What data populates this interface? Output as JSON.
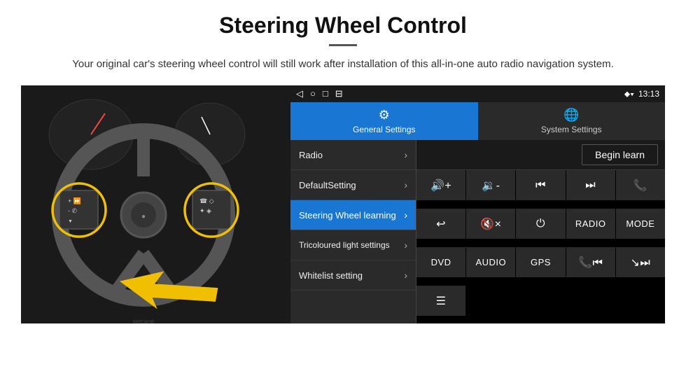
{
  "page": {
    "title": "Steering Wheel Control",
    "subtitle": "Your original car's steering wheel control will still work after installation of this all-in-one auto radio navigation system."
  },
  "status_bar": {
    "nav_back": "◁",
    "nav_home": "○",
    "nav_square": "□",
    "nav_extra": "⊟",
    "time": "13:13",
    "signal": "▼▲",
    "wifi": "⊕"
  },
  "tabs": [
    {
      "id": "general",
      "label": "General Settings",
      "active": true
    },
    {
      "id": "system",
      "label": "System Settings",
      "active": false
    }
  ],
  "menu_items": [
    {
      "id": "radio",
      "label": "Radio",
      "active": false
    },
    {
      "id": "default",
      "label": "DefaultSetting",
      "active": false
    },
    {
      "id": "steering",
      "label": "Steering Wheel learning",
      "active": true
    },
    {
      "id": "tricoloured",
      "label": "Tricoloured light settings",
      "active": false
    },
    {
      "id": "whitelist",
      "label": "Whitelist setting",
      "active": false
    }
  ],
  "begin_learn_label": "Begin learn",
  "control_buttons": [
    {
      "id": "vol-up",
      "label": "🔊+"
    },
    {
      "id": "vol-down",
      "label": "🔉-"
    },
    {
      "id": "prev-track",
      "label": "⏮"
    },
    {
      "id": "next-track",
      "label": "⏭"
    },
    {
      "id": "phone",
      "label": "📞"
    },
    {
      "id": "back",
      "label": "↩"
    },
    {
      "id": "mute",
      "label": "🔇×"
    },
    {
      "id": "power",
      "label": "⏻"
    },
    {
      "id": "radio-btn",
      "label": "RADIO"
    },
    {
      "id": "mode",
      "label": "MODE"
    },
    {
      "id": "dvd",
      "label": "DVD"
    },
    {
      "id": "audio",
      "label": "AUDIO"
    },
    {
      "id": "gps",
      "label": "GPS"
    },
    {
      "id": "tel-prev",
      "label": "📞⏮"
    },
    {
      "id": "next-end",
      "label": "↘⏭"
    },
    {
      "id": "list",
      "label": "☰"
    }
  ],
  "arrow": "➤"
}
